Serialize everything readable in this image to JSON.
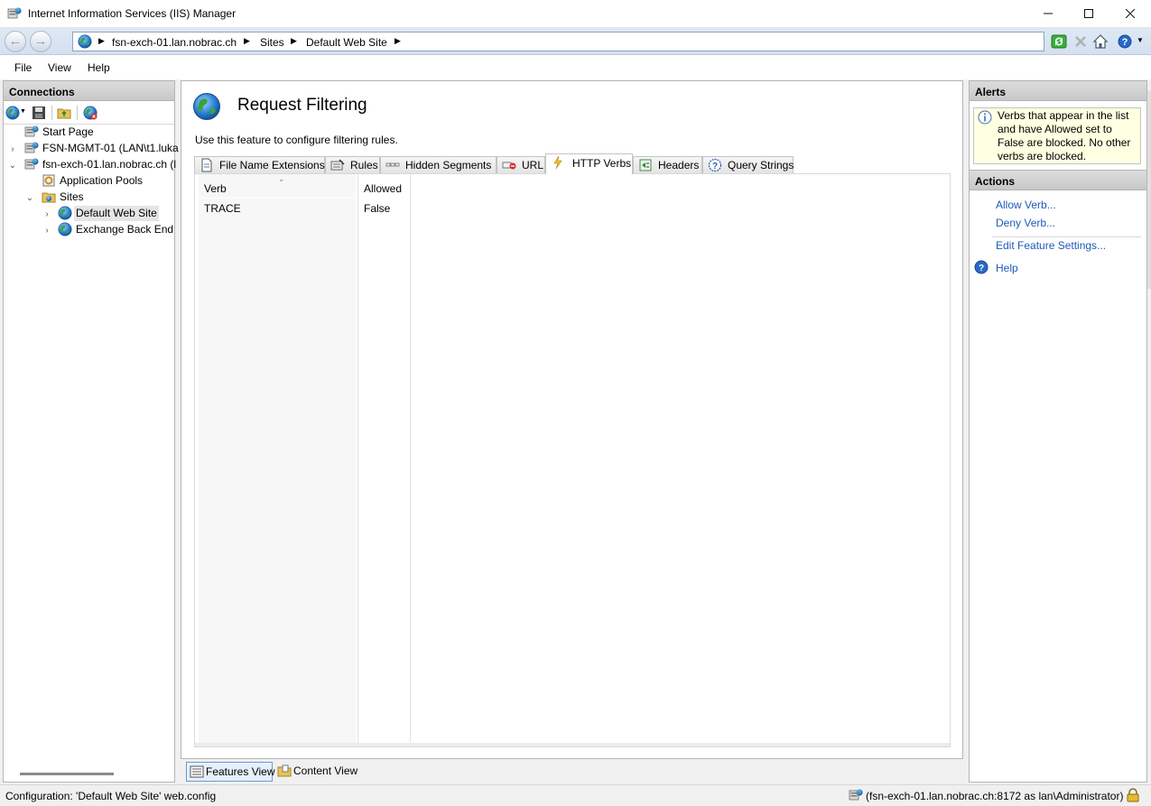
{
  "window": {
    "title": "Internet Information Services (IIS) Manager",
    "minimize_icon": "minimize-icon",
    "maximize_icon": "maximize-icon",
    "close_icon": "close-icon"
  },
  "address": {
    "crumbs": [
      "fsn-exch-01.lan.nobrac.ch",
      "Sites",
      "Default Web Site"
    ]
  },
  "menu": {
    "file": "File",
    "view": "View",
    "help": "Help"
  },
  "connections": {
    "header": "Connections",
    "tree": [
      {
        "label": "Start Page"
      },
      {
        "label": "FSN-MGMT-01 (LAN\\t1.luka"
      },
      {
        "label": "fsn-exch-01.lan.nobrac.ch (l"
      },
      {
        "label": "Application Pools"
      },
      {
        "label": "Sites"
      },
      {
        "label": "Default Web Site"
      },
      {
        "label": "Exchange Back End"
      }
    ]
  },
  "main": {
    "title": "Request Filtering",
    "description": "Use this feature to configure filtering rules.",
    "tabs": [
      {
        "label": "File Name Extensions",
        "icon": "file-extension-icon"
      },
      {
        "label": "Rules",
        "icon": "rules-icon"
      },
      {
        "label": "Hidden Segments",
        "icon": "hidden-segments-icon"
      },
      {
        "label": "URL",
        "icon": "url-icon"
      },
      {
        "label": "HTTP Verbs",
        "icon": "http-verbs-icon"
      },
      {
        "label": "Headers",
        "icon": "headers-icon"
      },
      {
        "label": "Query Strings",
        "icon": "query-strings-icon"
      }
    ],
    "active_tab": "HTTP Verbs",
    "table": {
      "columns": [
        "Verb",
        "Allowed"
      ],
      "rows": [
        {
          "verb": "TRACE",
          "allowed": "False"
        }
      ]
    }
  },
  "viewbar": {
    "features_view": "Features View",
    "content_view": "Content View"
  },
  "alerts": {
    "header": "Alerts",
    "message": "Verbs that appear in the list and have Allowed set to False are blocked. No other verbs are blocked."
  },
  "actions": {
    "header": "Actions",
    "allow_verb": "Allow Verb...",
    "deny_verb": "Deny Verb...",
    "edit_feature_settings": "Edit Feature Settings...",
    "help": "Help"
  },
  "status": {
    "left": "Configuration: 'Default Web Site' web.config",
    "right": "(fsn-exch-01.lan.nobrac.ch:8172 as lan\\Administrator)"
  },
  "colors": {
    "link": "#1e5bb6",
    "alert_bg": "#ffffe1",
    "address_bar": "#d3e0f0"
  }
}
